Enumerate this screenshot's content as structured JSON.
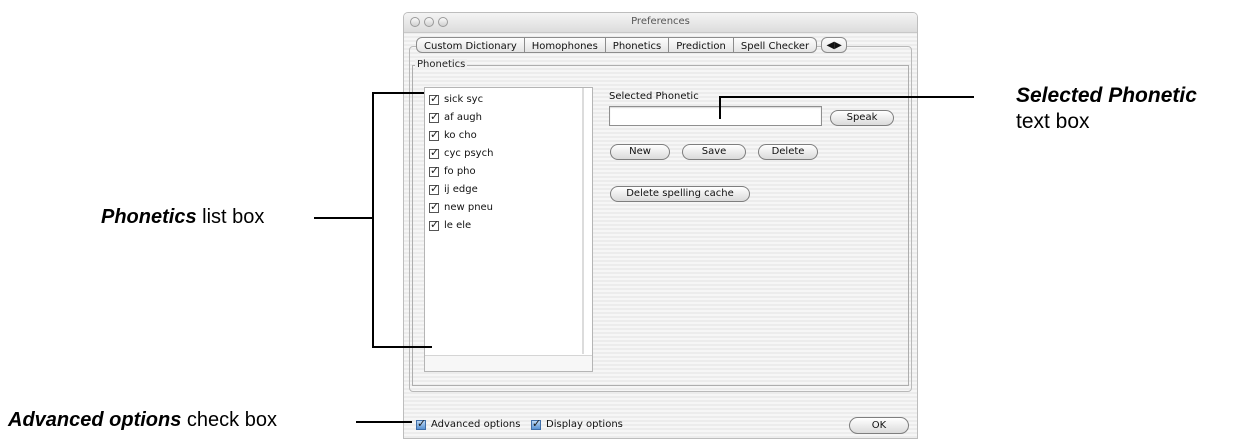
{
  "window": {
    "title": "Preferences",
    "tabs": [
      "Custom Dictionary",
      "Homophones",
      "Phonetics",
      "Prediction",
      "Spell Checker"
    ],
    "tab_scroll_arrows": "◀▶",
    "group_label": "Phonetics",
    "phonetics_list": [
      {
        "label": "sick syc",
        "checked": true
      },
      {
        "label": "af augh",
        "checked": true
      },
      {
        "label": "ko cho",
        "checked": true
      },
      {
        "label": "cyc psych",
        "checked": true
      },
      {
        "label": "fo pho",
        "checked": true
      },
      {
        "label": "ij edge",
        "checked": true
      },
      {
        "label": "new pneu",
        "checked": true
      },
      {
        "label": "le ele",
        "checked": true
      }
    ],
    "selected_phonetic_label": "Selected Phonetic",
    "selected_phonetic_value": "",
    "buttons": {
      "speak": "Speak",
      "new": "New",
      "save": "Save",
      "delete": "Delete",
      "delete_cache": "Delete spelling cache",
      "ok": "OK"
    },
    "advanced_options": {
      "label": "Advanced options",
      "checked": true
    },
    "display_options": {
      "label": "Display options",
      "checked": true
    }
  },
  "annotations": {
    "phonetics_bold": "Phonetics",
    "phonetics_rest": " list box",
    "selected_bold": "Selected Phonetic",
    "selected_rest": "text box",
    "advanced_bold": "Advanced options",
    "advanced_rest": " check box"
  }
}
